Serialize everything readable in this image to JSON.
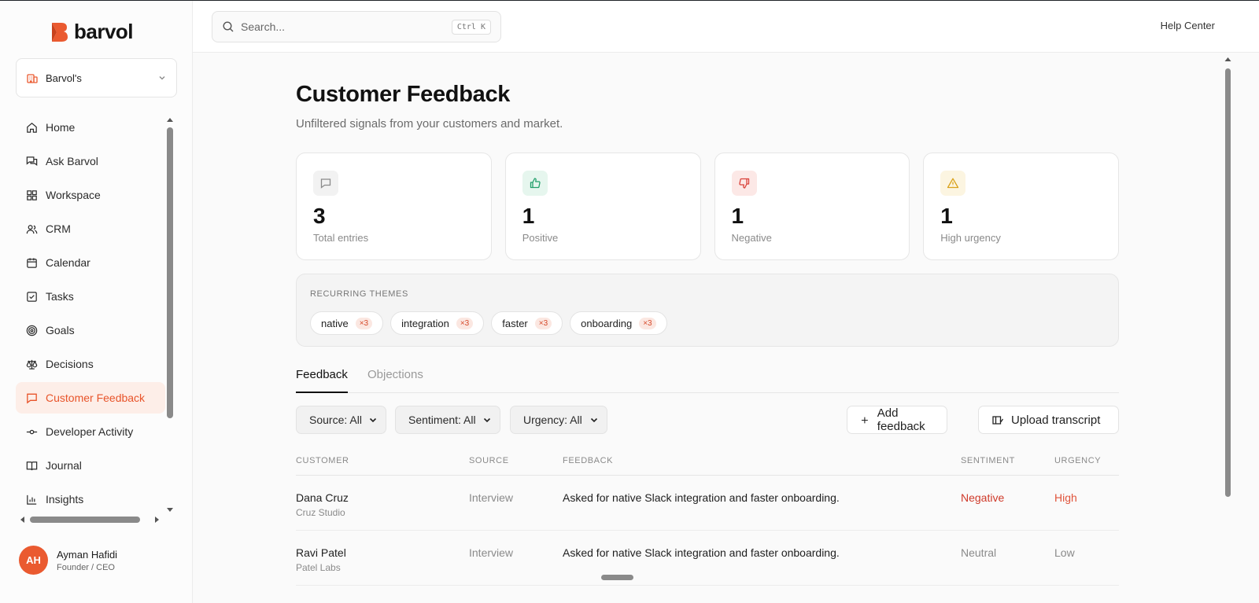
{
  "brand": {
    "name": "barvol",
    "accent": "#EA5A30"
  },
  "org": {
    "name": "Barvol's",
    "icon": "building-icon"
  },
  "nav": {
    "items": [
      {
        "label": "Home",
        "icon": "home-icon"
      },
      {
        "label": "Ask Barvol",
        "icon": "chat-bubbles-icon"
      },
      {
        "label": "Workspace",
        "icon": "grid-icon"
      },
      {
        "label": "CRM",
        "icon": "users-icon"
      },
      {
        "label": "Calendar",
        "icon": "calendar-icon"
      },
      {
        "label": "Tasks",
        "icon": "checkbox-icon"
      },
      {
        "label": "Goals",
        "icon": "target-icon"
      },
      {
        "label": "Decisions",
        "icon": "scale-icon"
      },
      {
        "label": "Customer Feedback",
        "icon": "message-square-icon",
        "active": true
      },
      {
        "label": "Developer Activity",
        "icon": "commit-icon"
      },
      {
        "label": "Journal",
        "icon": "book-icon"
      },
      {
        "label": "Insights",
        "icon": "bar-chart-icon"
      }
    ]
  },
  "user": {
    "initials": "AH",
    "name": "Ayman Hafidi",
    "role": "Founder / CEO"
  },
  "topbar": {
    "search_placeholder": "Search...",
    "search_shortcut": "Ctrl K",
    "help_label": "Help Center"
  },
  "page": {
    "title": "Customer Feedback",
    "subtitle": "Unfiltered signals from your customers and market."
  },
  "stats": [
    {
      "value": "3",
      "label": "Total entries",
      "icon": "message-square-icon",
      "color": "#8A8A8A",
      "bg": "#F2F2F2"
    },
    {
      "value": "1",
      "label": "Positive",
      "icon": "thumbs-up-icon",
      "color": "#22A06B",
      "bg": "#E6F6EE"
    },
    {
      "value": "1",
      "label": "Negative",
      "icon": "thumbs-down-icon",
      "color": "#D9413A",
      "bg": "#FCE8E6"
    },
    {
      "value": "1",
      "label": "High urgency",
      "icon": "warning-triangle-icon",
      "color": "#D9A21B",
      "bg": "#FCF5E1"
    }
  ],
  "themes": {
    "label": "RECURRING THEMES",
    "items": [
      {
        "label": "native",
        "count": "×3"
      },
      {
        "label": "integration",
        "count": "×3"
      },
      {
        "label": "faster",
        "count": "×3"
      },
      {
        "label": "onboarding",
        "count": "×3"
      }
    ]
  },
  "tabs": {
    "active": "Feedback",
    "inactive": "Objections"
  },
  "filters": {
    "source": "Source: All",
    "sentiment": "Sentiment: All",
    "urgency": "Urgency: All",
    "add_label": "Add feedback",
    "upload_label": "Upload transcript"
  },
  "table": {
    "headers": {
      "customer": "CUSTOMER",
      "source": "SOURCE",
      "feedback": "FEEDBACK",
      "sentiment": "SENTIMENT",
      "urgency": "URGENCY"
    },
    "rows": [
      {
        "customer": "Dana Cruz",
        "company": "Cruz Studio",
        "source": "Interview",
        "feedback": "Asked for native Slack integration and faster onboarding.",
        "sentiment": "Negative",
        "urgency": "High"
      },
      {
        "customer": "Ravi Patel",
        "company": "Patel Labs",
        "source": "Interview",
        "feedback": "Asked for native Slack integration and faster onboarding.",
        "sentiment": "Neutral",
        "urgency": "Low"
      }
    ]
  }
}
